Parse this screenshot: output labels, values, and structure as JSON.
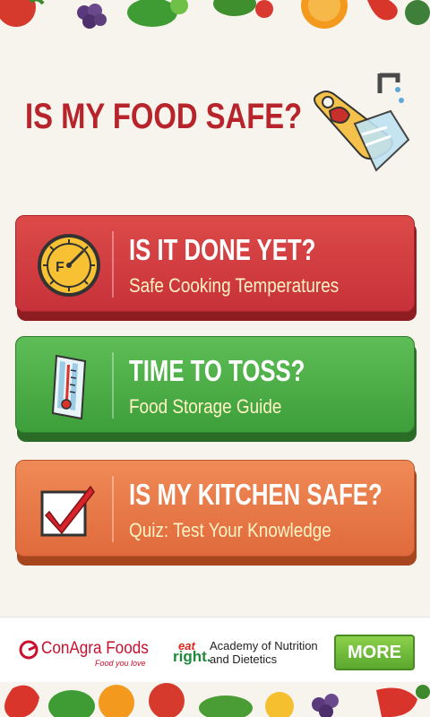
{
  "header": {
    "title": "IS MY FOOD SAFE?"
  },
  "menu": [
    {
      "title": "IS IT DONE YET?",
      "subtitle": "Safe Cooking Temperatures",
      "icon": "thermometer-dial-icon",
      "color": "#d0393f"
    },
    {
      "title": "TIME TO TOSS?",
      "subtitle": "Food Storage Guide",
      "icon": "thermometer-icon",
      "color": "#4cae47"
    },
    {
      "title": "IS MY KITCHEN SAFE?",
      "subtitle": "Quiz: Test Your Knowledge",
      "icon": "checkbox-check-icon",
      "color": "#e77a49"
    }
  ],
  "footer": {
    "sponsor1_name": "ConAgra Foods",
    "sponsor1_tagline": "Food you love",
    "sponsor2_mark_top": "eat",
    "sponsor2_mark_bottom": "right.",
    "sponsor2_line1": "Academy of Nutrition",
    "sponsor2_line2": "and Dietetics",
    "more_label": "MORE"
  }
}
